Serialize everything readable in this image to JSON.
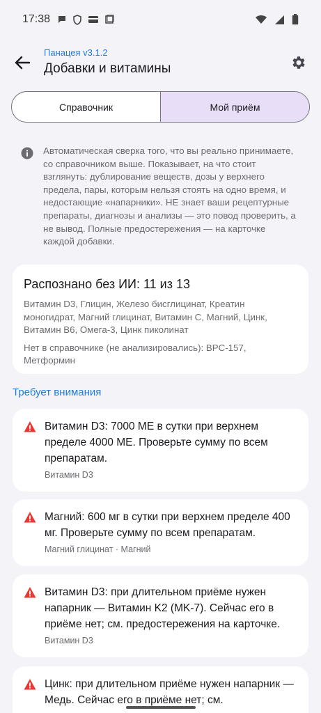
{
  "status": {
    "time": "17:38"
  },
  "header": {
    "version": "Панацея v3.1.2",
    "title": "Добавки и витамины"
  },
  "tabs": [
    {
      "label": "Справочник",
      "active": false
    },
    {
      "label": "Мой приём",
      "active": true
    }
  ],
  "info": {
    "text": "Автоматическая сверка того, что вы реально принимаете, со справочником выше. Показывает, на что стоит взглянуть: дублирование веществ, дозы у верхнего предела, пары, которым нельзя стоять на одно время, и недостающие «напарники». НЕ знает ваши рецептурные препараты, диагнозы и анализы — это повод проверить, а не вывод. Полные предостережения — на карточке каждой добавки."
  },
  "summary": {
    "title": "Распознано без ИИ: 11 из 13",
    "recognized": "Витамин D3, Глицин, Железо бисглицинат, Креатин моногидрат, Магний глицинат, Витамин C, Магний, Цинк, Витамин B6, Омега-3, Цинк пиколинат",
    "not_found": "Нет в справочнике (не анализировались): BPC-157, Метформин"
  },
  "attention": {
    "title": "Требует внимания",
    "items": [
      {
        "text": "Витамин D3: 7000 МЕ в сутки при верхнем пределе 4000 МЕ. Проверьте сумму по всем препаратам.",
        "tag": "Витамин D3"
      },
      {
        "text": "Магний: 600 мг в сутки при верхнем пределе 400 мг. Проверьте сумму по всем препаратам.",
        "tag": "Магний глицинат · Магний"
      },
      {
        "text": "Витамин D3: при длительном приёме нужен напарник — Витамин K2 (MK-7). Сейчас его в приёме нет; см. предостережения на карточке.",
        "tag": "Витамин D3"
      },
      {
        "text": "Цинк: при длительном приёме нужен напарник — Медь. Сейчас его в приёме нет; см.",
        "tag": ""
      }
    ]
  },
  "colors": {
    "accent": "#1e7ce0",
    "warning": "#e53935",
    "selected_tab": "#e8def8"
  }
}
